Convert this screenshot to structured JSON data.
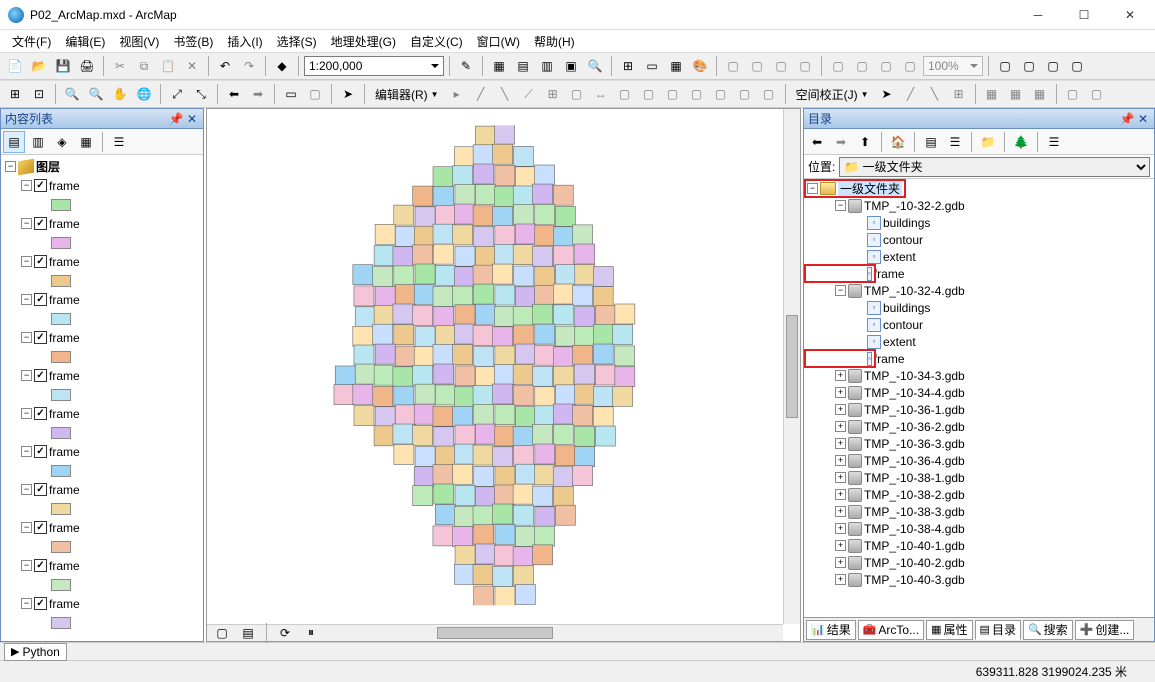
{
  "window": {
    "title": "P02_ArcMap.mxd - ArcMap"
  },
  "menu": [
    "文件(F)",
    "编辑(E)",
    "视图(V)",
    "书签(B)",
    "插入(I)",
    "选择(S)",
    "地理处理(G)",
    "自定义(C)",
    "窗口(W)",
    "帮助(H)"
  ],
  "scale": "1:200,000",
  "zoom_pct": "100%",
  "editor_label": "编辑器(R)",
  "spatial_adj_label": "空间校正(J)",
  "toc": {
    "title": "内容列表",
    "root": "图层",
    "layers": [
      {
        "name": "frame",
        "color": "#a7e6a6"
      },
      {
        "name": "frame",
        "color": "#e7b5e9"
      },
      {
        "name": "frame",
        "color": "#eec98d"
      },
      {
        "name": "frame",
        "color": "#b8e6f0"
      },
      {
        "name": "frame",
        "color": "#f1b58a"
      },
      {
        "name": "frame",
        "color": "#bde3f5"
      },
      {
        "name": "frame",
        "color": "#d1b7f2"
      },
      {
        "name": "frame",
        "color": "#9fd4f5"
      },
      {
        "name": "frame",
        "color": "#f0d9a0"
      },
      {
        "name": "frame",
        "color": "#f0c0a5"
      },
      {
        "name": "frame",
        "color": "#c6e8c0"
      },
      {
        "name": "frame",
        "color": "#d5c7ef"
      }
    ]
  },
  "catalog": {
    "title": "目录",
    "location_label": "位置:",
    "location_value": "一级文件夹",
    "root": "一级文件夹",
    "expanded": [
      {
        "name": "TMP_-10-32-2.gdb",
        "children": [
          "buildings",
          "contour",
          "extent",
          "frame"
        ],
        "frame_hl": true
      },
      {
        "name": "TMP_-10-32-4.gdb",
        "children": [
          "buildings",
          "contour",
          "extent",
          "frame"
        ],
        "frame_hl": true
      }
    ],
    "collapsed": [
      "TMP_-10-34-3.gdb",
      "TMP_-10-34-4.gdb",
      "TMP_-10-36-1.gdb",
      "TMP_-10-36-2.gdb",
      "TMP_-10-36-3.gdb",
      "TMP_-10-36-4.gdb",
      "TMP_-10-38-1.gdb",
      "TMP_-10-38-2.gdb",
      "TMP_-10-38-3.gdb",
      "TMP_-10-38-4.gdb",
      "TMP_-10-40-1.gdb",
      "TMP_-10-40-2.gdb",
      "TMP_-10-40-3.gdb"
    ]
  },
  "bottom_tabs": {
    "results": "结果",
    "arcto": "ArcTo...",
    "attrs": "属性",
    "catalog": "目录",
    "search": "搜索",
    "create": "创建..."
  },
  "python_tab": "Python",
  "coords": "639311.828 3199024.235 米"
}
